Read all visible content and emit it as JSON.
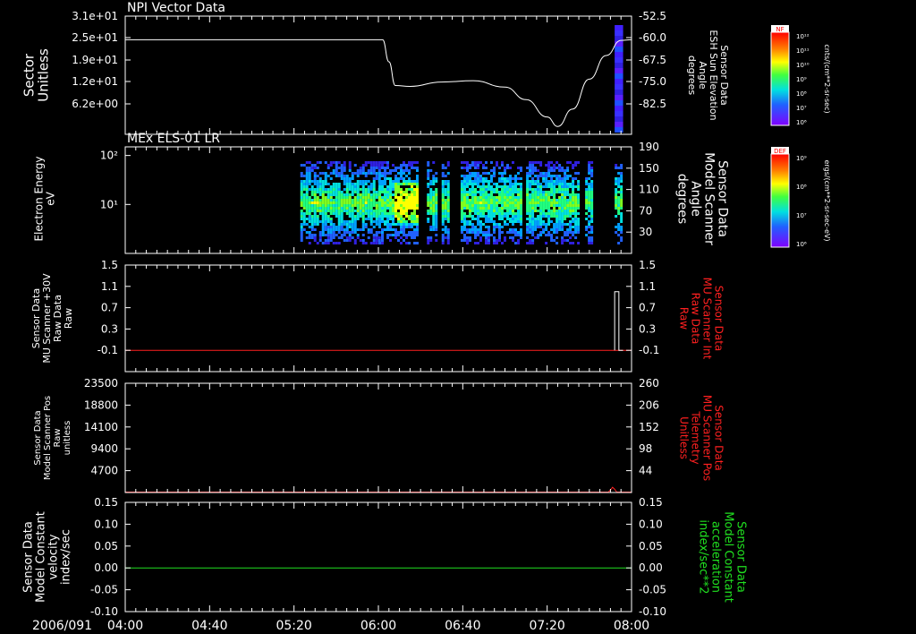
{
  "colors": {
    "bg": "#000000",
    "axis": "#ffffff",
    "line": "#ffffff",
    "red": "#ff2020",
    "green": "#20e020"
  },
  "time_axis": {
    "date_label": "2006/091",
    "ticks": [
      "04:00",
      "04:40",
      "05:20",
      "06:00",
      "06:40",
      "07:20",
      "08:00"
    ]
  },
  "chart_data": [
    {
      "type": "line",
      "title": "NPI Vector Data",
      "left_axis": {
        "label_lines": [
          "Sector",
          "Unitless"
        ],
        "ticks": [
          "3.1e+01",
          "2.5e+01",
          "1.9e+01",
          "1.2e+01",
          "6.2e+00"
        ],
        "ylim": [
          0,
          31
        ]
      },
      "right_axis": {
        "label_lines": [
          "Sensor Data",
          "ESH Sun Elevation",
          "Angle",
          "degrees"
        ],
        "ticks": [
          "-52.5",
          "-60.0",
          "-67.5",
          "-75.0",
          "-82.5"
        ],
        "ylim": [
          -90,
          -52.5
        ]
      },
      "series": [
        {
          "axis": "right",
          "color": "#ffffff",
          "x": [
            "04:00",
            "05:50",
            "06:02",
            "06:05",
            "06:08",
            "06:15",
            "06:30",
            "06:45",
            "07:00",
            "07:10",
            "07:20",
            "07:25",
            "07:32",
            "07:40",
            "07:48",
            "07:55",
            "08:00"
          ],
          "y": [
            -60,
            -60,
            -60,
            -67,
            -74.5,
            -74.8,
            -73.4,
            -73,
            -75,
            -79,
            -84.5,
            -87.5,
            -82,
            -72.5,
            -65,
            -60.2,
            -60
          ]
        }
      ],
      "colorbar": {
        "label": "NF",
        "units": "cnts/(cm**2-sr-sec)",
        "ticks": [
          "10¹²",
          "10¹¹",
          "10¹⁰",
          "10⁹",
          "10⁸",
          "10⁷",
          "10⁶"
        ]
      },
      "sector_strip": {
        "x_range": [
          "07:52",
          "07:56"
        ],
        "color": "#4020ff"
      }
    },
    {
      "type": "heatmap",
      "title": "MEx ELS-01 LR",
      "left_axis": {
        "label_lines": [
          "Electron Energy",
          "eV"
        ],
        "ticks": [
          "10²",
          "10¹"
        ],
        "scale": "log",
        "ylim": [
          1,
          150
        ]
      },
      "right_axis": {
        "label_lines": [
          "Sensor Data",
          "Model Scanner",
          "Angle",
          "degrees"
        ],
        "ticks": [
          "190",
          "150",
          "110",
          "70",
          "30"
        ],
        "ylim": [
          -10,
          190
        ]
      },
      "data_segments": [
        [
          "05:23",
          "06:00"
        ],
        [
          "06:00",
          "06:18"
        ],
        [
          "06:23",
          "06:27"
        ],
        [
          "06:30",
          "06:33"
        ],
        [
          "06:39",
          "07:07"
        ],
        [
          "07:10",
          "07:35"
        ],
        [
          "07:38",
          "07:41"
        ],
        [
          "07:52",
          "07:55"
        ]
      ],
      "colorbar": {
        "label": "DEF",
        "units": "ergs/(cm**2-sr-sec-eV)",
        "ticks": [
          "10⁹",
          "10⁸",
          "10⁷",
          "10⁶"
        ]
      }
    },
    {
      "type": "line",
      "left_axis": {
        "label_lines": [
          "Sensor Data",
          "MU Scanner +30V",
          "Raw Data",
          "Raw"
        ],
        "ticks": [
          "1.5",
          "1.1",
          "0.7",
          "0.3",
          "-0.1"
        ],
        "ylim": [
          -0.5,
          1.5
        ]
      },
      "right_axis": {
        "label_lines": [
          "Sensor Data",
          "MU Scanner Int",
          "Raw Data",
          "Raw"
        ],
        "ticks": [
          "1.5",
          "1.1",
          "0.7",
          "0.3",
          "-0.1"
        ],
        "ylim": [
          -0.5,
          1.5
        ],
        "color": "#ff2020"
      },
      "series": [
        {
          "axis": "right",
          "color": "#ff2020",
          "x": [
            "04:00",
            "08:00"
          ],
          "y": [
            -0.1,
            -0.1
          ]
        },
        {
          "axis": "left",
          "color": "#ffffff",
          "x": [
            "07:52",
            "07:52",
            "07:54",
            "07:54",
            "07:56",
            "07:56"
          ],
          "y": [
            -0.1,
            1.0,
            1.0,
            -0.1,
            -0.1,
            -0.1
          ]
        }
      ]
    },
    {
      "type": "line",
      "left_axis": {
        "label_lines": [
          "Sensor Data",
          "Model Scanner Pos",
          "Raw",
          "unitless"
        ],
        "ticks": [
          "23500",
          "18800",
          "14100",
          "9400",
          "4700"
        ],
        "ylim": [
          0,
          23500
        ]
      },
      "right_axis": {
        "label_lines": [
          "Sensor Data",
          "MU Scanner Pos",
          "Telemetry",
          "Unitless"
        ],
        "ticks": [
          "260",
          "206",
          "152",
          "98",
          "44"
        ],
        "ylim": [
          -10,
          260
        ],
        "color": "#ff2020"
      },
      "series": [
        {
          "axis": "right",
          "color": "#ff2020",
          "x": [
            "04:00",
            "05:00",
            "06:00",
            "07:00",
            "07:49",
            "07:50",
            "07:51",
            "07:52",
            "07:53",
            "08:00"
          ],
          "y": [
            -9,
            -9,
            -9,
            -9,
            -9,
            -4,
            3,
            -2,
            -9,
            -9
          ]
        },
        {
          "axis": "left",
          "color": "#ffffff",
          "x": [
            "04:00",
            "08:00"
          ],
          "y": [
            0,
            0
          ]
        }
      ]
    },
    {
      "type": "line",
      "left_axis": {
        "label_lines": [
          "Sensor Data",
          "Model Constant",
          "velocity",
          "index/sec"
        ],
        "ticks": [
          "0.15",
          "0.10",
          "0.05",
          "0.00",
          "-0.05",
          "-0.10"
        ],
        "ylim": [
          -0.1,
          0.15
        ]
      },
      "right_axis": {
        "label_lines": [
          "Sensor Data",
          "Model Constant",
          "acceleration",
          "index/sec**2"
        ],
        "ticks": [
          "0.15",
          "0.10",
          "0.05",
          "0.00",
          "-0.05",
          "-0.10"
        ],
        "ylim": [
          -0.1,
          0.15
        ],
        "color": "#20e020"
      },
      "series": [
        {
          "axis": "right",
          "color": "#20e020",
          "x": [
            "04:00",
            "08:00"
          ],
          "y": [
            0,
            0
          ]
        }
      ]
    }
  ]
}
